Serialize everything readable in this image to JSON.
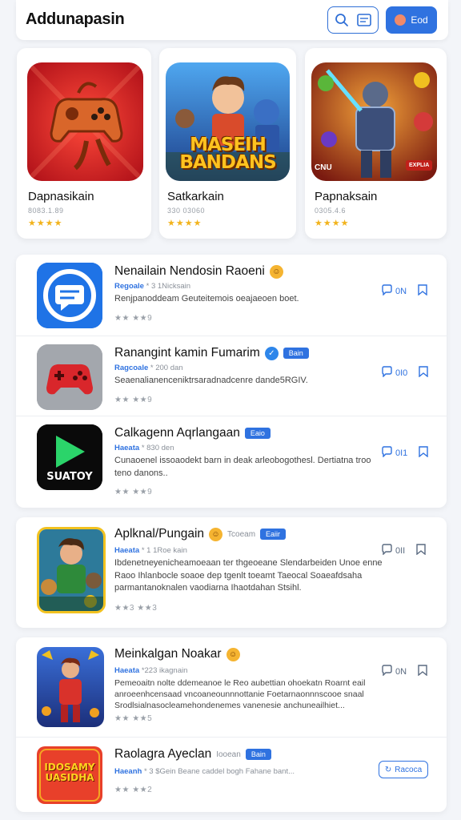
{
  "header": {
    "title": "Addunapasin",
    "search_icon": "search-icon",
    "doc_icon": "document-icon",
    "primary_label": "Eod",
    "accent": "#2f72e0"
  },
  "featured": [
    {
      "name": "Dapnasikain",
      "meta": "8083.1.89",
      "stars": "★★★★"
    },
    {
      "name": "Satkarkain",
      "meta": "330 03060",
      "stars": "★★★★"
    },
    {
      "name": "Papnaksain",
      "meta": "0305.4.6",
      "stars": "★★★★"
    }
  ],
  "featured_art": {
    "game2_line1": "MASEIH",
    "game2_line2": "BANDANS",
    "game3_badge": "CNU",
    "game3_chip": "EXPLIA"
  },
  "list": [
    {
      "title": "Nenailain Nendosin Raoeni",
      "category": "Regoale",
      "info": "* 3 1Nicksain",
      "desc": "Renjpanoddeam Geuteitemois oeajaeoen boet.",
      "rating": "★★ ★★9",
      "action": "0N",
      "emoji": true
    },
    {
      "title": "Ranangint kamin Fumarim",
      "category": "Ragcoale",
      "info": "* 200 dan",
      "desc": "Seaenalianenceniktrsaradnadcenre dande5RGIV.",
      "rating": "★★ ★★9",
      "action": "0I0",
      "badge": "Bain",
      "verified": true
    },
    {
      "title": "Calkagenn Aqrlangaan",
      "category": "Haeata",
      "info": "* 830 den",
      "desc": "Cunaoenel issoaodekt barn in deak arleobogothesl. Dertiatna troo teno danons..",
      "rating": "★★ ★★9",
      "action": "0I1",
      "badge": "Eaio",
      "icon_text": "SUATOY"
    },
    {
      "title": "Aplknal/Pungain",
      "category": "Haeata",
      "info": "* 1 1Roe kain",
      "meta_extra": "Tcoeam",
      "desc": "Ibdenetneyenicheamoeaan ter thgeoeane Slendarbeiden Unoe enne Raoo Ihlanbocle soaoe dep tgenlt toeamt Taeocal Soaeafdsaha parmantanoknalen vaodiarna Ihaotdahan Stsihl.",
      "rating": "★★3 ★★3",
      "action": "0II",
      "badge": "Eaiir",
      "emoji": true
    },
    {
      "title": "Meinkalgan Noakar",
      "category": "Haeata",
      "info": "*223 ikagnain",
      "desc": "Pemeoaitn nolte ddemeanoe le Reo aubettian ohoekatn Roarnt eail anroeenhcensaad vncoaneounnnottanie Foetarnaonnnscooe snaal Srodlsialnasocleamehondenemes vanenesie anchuneailhiet...",
      "rating": "★★ ★★5",
      "action": "0N",
      "emoji": true
    },
    {
      "title": "Raolagra Ayeclan",
      "category": "Haeanh",
      "info": "* 3 $Gein Beane caddel bogh Fahane bant...",
      "meta_extra": "Iooean",
      "rating": "★★ ★★2",
      "action_outline": "Racoca",
      "badge": "Bain",
      "icon_text": "IDOSAMY UASIDHA"
    }
  ]
}
